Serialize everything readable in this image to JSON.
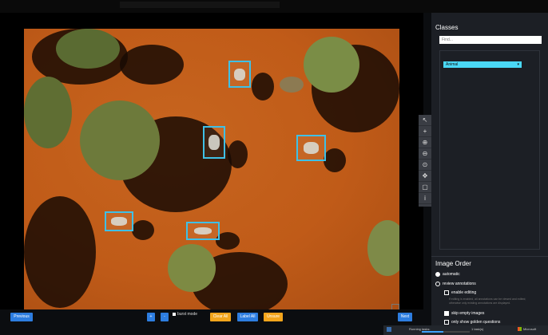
{
  "sidebar": {
    "classes_title": "Classes",
    "search_placeholder": "Find...",
    "class_items": [
      {
        "label": "Animal"
      }
    ],
    "image_order_title": "Image Order",
    "order_options": [
      {
        "label": "automatic",
        "selected": true
      },
      {
        "label": "review annotations",
        "selected": false
      }
    ],
    "checkboxes": [
      {
        "label": "enable editing",
        "checked": false
      },
      {
        "label": "skip empty images",
        "checked": true
      },
      {
        "label": "only show golden questions",
        "checked": false
      }
    ],
    "editing_note": "If editing is enabled, all annotations can be viewed and edited; otherwise only existing annotations are displayed."
  },
  "toolbar": {
    "tools": [
      {
        "icon": "arrow-icon",
        "glyph": "↖"
      },
      {
        "icon": "add-box-icon",
        "glyph": "+"
      },
      {
        "icon": "zoom-in-icon",
        "glyph": "⊕"
      },
      {
        "icon": "zoom-out-icon",
        "glyph": "⊖"
      },
      {
        "icon": "zoom-reset-icon",
        "glyph": "⊙"
      },
      {
        "icon": "pan-icon",
        "glyph": "✥"
      },
      {
        "icon": "select-box-icon",
        "glyph": "▢"
      },
      {
        "icon": "info-icon",
        "glyph": "i"
      }
    ]
  },
  "bottom": {
    "previous_label": "Previous",
    "plus_label": "+",
    "minus_label": "-",
    "burst_mode_label": "burst mode",
    "clear_all_label": "Clear All",
    "label_all_label": "Label All",
    "unsure_label": "Unsure",
    "next_label": "Next"
  },
  "taskbar": {
    "running_label": "Running tasks:",
    "progress_percent": 45,
    "progress_text": "1 task(s)",
    "brand": "Microsoft"
  },
  "colors": {
    "accent": "#3fc0e6",
    "primary_button": "#2d7de0",
    "warning_button": "#f3a51c",
    "class_highlight": "#4ad8f6"
  }
}
